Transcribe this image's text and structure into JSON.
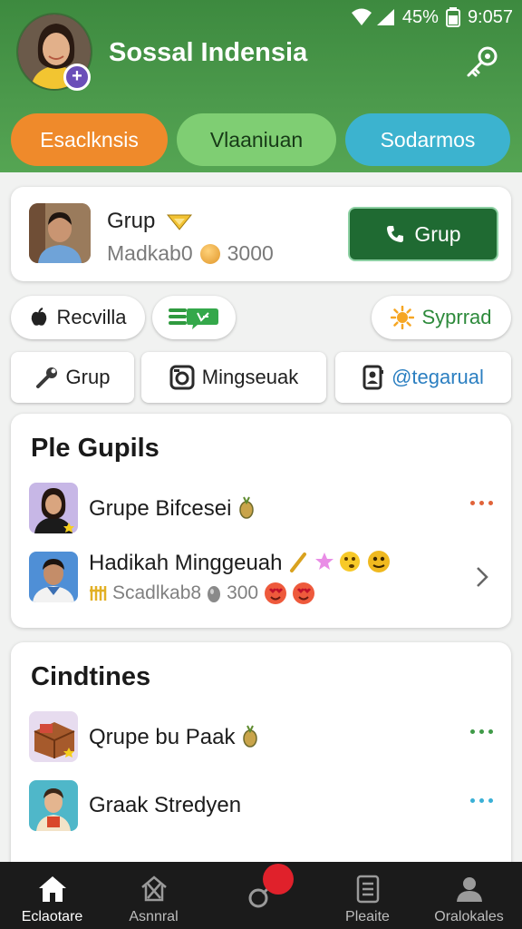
{
  "status_bar": {
    "battery": "45%",
    "time": "9:057"
  },
  "app": {
    "title": "Sossal Indensia"
  },
  "tabs": [
    {
      "label": "Esaclknsis",
      "color": "#ef8a2b"
    },
    {
      "label": "Vlaaniuan",
      "color": "#7fce73"
    },
    {
      "label": "Sodarmos",
      "color": "#3cb3cf"
    }
  ],
  "profile": {
    "name": "Grup",
    "sub": "Madkab0",
    "points": "3000",
    "call_label": "Grup"
  },
  "chips_row1": [
    {
      "label": "Recvilla"
    },
    {
      "label": ""
    },
    {
      "label": "Syprrad"
    }
  ],
  "chips_row2": [
    {
      "label": "Grup"
    },
    {
      "label": "Mingseuak"
    },
    {
      "label": "@tegarual"
    }
  ],
  "groups": {
    "title": "Ple Gupils",
    "items": [
      {
        "title": "Grupe Bifcesei"
      },
      {
        "title": "Hadikah Minggeuah",
        "sub": "Scadlkab8",
        "points": "300"
      }
    ]
  },
  "contacts": {
    "title": "Cindtines",
    "items": [
      {
        "title": "Qrupe bu Paak"
      },
      {
        "title": "Graak Stredyen"
      }
    ]
  },
  "bottom_nav": [
    {
      "label": "Eclaotare",
      "icon": "home-icon"
    },
    {
      "label": "Asnnral",
      "icon": "explore-icon"
    },
    {
      "label": "",
      "icon": "link-icon"
    },
    {
      "label": "Pleaite",
      "icon": "document-icon"
    },
    {
      "label": "Oralokales",
      "icon": "profile-icon"
    }
  ],
  "colors": {
    "header_green": "#4c9a4c",
    "call_button": "#1f6a32",
    "recording_dot": "#e0212b"
  }
}
